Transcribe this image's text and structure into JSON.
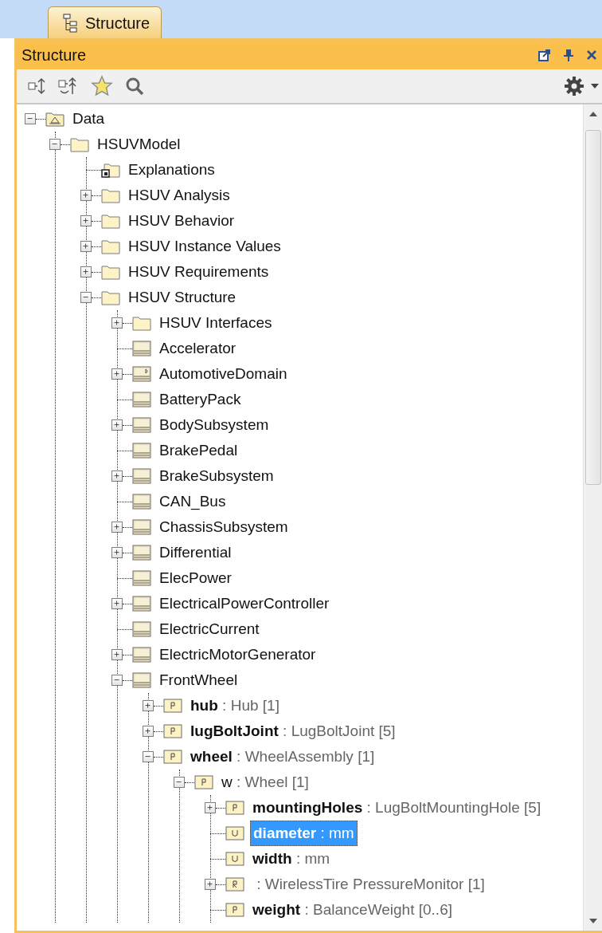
{
  "tab": {
    "label": "Structure",
    "selected": true
  },
  "panel": {
    "title": "Structure"
  },
  "tree": [
    {
      "label": "Data",
      "kind": "model",
      "expanded": true,
      "selected": false,
      "children": [
        {
          "label": "HSUVModel",
          "kind": "folder",
          "expanded": true,
          "selected": false,
          "children": [
            {
              "label": "Explanations",
              "kind": "diagram",
              "selected": false
            },
            {
              "label": "HSUV Analysis",
              "kind": "folder",
              "expanded": false,
              "selected": false
            },
            {
              "label": "HSUV Behavior",
              "kind": "folder",
              "expanded": false,
              "selected": false
            },
            {
              "label": "HSUV Instance Values",
              "kind": "folder",
              "expanded": false,
              "selected": false
            },
            {
              "label": "HSUV Requirements",
              "kind": "folder",
              "expanded": false,
              "selected": false
            },
            {
              "label": "HSUV Structure",
              "kind": "folder",
              "expanded": true,
              "selected": false,
              "children": [
                {
                  "label": "HSUV Interfaces",
                  "kind": "folder",
                  "expanded": false,
                  "selected": false
                },
                {
                  "label": "Accelerator",
                  "kind": "block",
                  "selected": false
                },
                {
                  "label": "AutomotiveDomain",
                  "kind": "domain-block",
                  "expanded": false,
                  "selected": false
                },
                {
                  "label": "BatteryPack",
                  "kind": "block",
                  "selected": false
                },
                {
                  "label": "BodySubsystem",
                  "kind": "block",
                  "expanded": false,
                  "selected": false
                },
                {
                  "label": "BrakePedal",
                  "kind": "block",
                  "selected": false
                },
                {
                  "label": "BrakeSubsystem",
                  "kind": "block",
                  "expanded": false,
                  "selected": false
                },
                {
                  "label": "CAN_Bus",
                  "kind": "block",
                  "selected": false
                },
                {
                  "label": "ChassisSubsystem",
                  "kind": "block",
                  "expanded": false,
                  "selected": false
                },
                {
                  "label": "Differential",
                  "kind": "block",
                  "expanded": false,
                  "selected": false
                },
                {
                  "label": "ElecPower",
                  "kind": "block",
                  "selected": false
                },
                {
                  "label": "ElectricalPowerController",
                  "kind": "block",
                  "expanded": false,
                  "selected": false
                },
                {
                  "label": "ElectricCurrent",
                  "kind": "block",
                  "selected": false
                },
                {
                  "label": "ElectricMotorGenerator",
                  "kind": "block",
                  "expanded": false,
                  "selected": false
                },
                {
                  "label": "FrontWheel",
                  "kind": "block",
                  "expanded": true,
                  "selected": false,
                  "children": [
                    {
                      "label": "hub",
                      "type": ": Hub [1]",
                      "bold": true,
                      "kind": "part",
                      "expanded": false,
                      "selected": false
                    },
                    {
                      "label": "lugBoltJoint",
                      "type": ": LugBoltJoint [5]",
                      "bold": true,
                      "kind": "part",
                      "expanded": false,
                      "selected": false
                    },
                    {
                      "label": "wheel",
                      "type": ": WheelAssembly [1]",
                      "bold": true,
                      "kind": "part",
                      "expanded": true,
                      "selected": false,
                      "children": [
                        {
                          "label": "w",
                          "type": ": Wheel [1]",
                          "bold": false,
                          "kind": "part",
                          "expanded": true,
                          "selected": false,
                          "children": [
                            {
                              "label": "mountingHoles",
                              "type": ": LugBoltMountingHole [5]",
                              "bold": true,
                              "kind": "part",
                              "expanded": false,
                              "selected": false
                            },
                            {
                              "label": "diameter",
                              "type": ": mm",
                              "bold": true,
                              "kind": "value",
                              "selected": true
                            },
                            {
                              "label": "width",
                              "type": ": mm",
                              "bold": true,
                              "kind": "value",
                              "selected": false
                            },
                            {
                              "type": ": WirelessTire PressureMonitor [1]",
                              "bold": true,
                              "kind": "reference",
                              "expanded": false,
                              "selected": false
                            },
                            {
                              "label": "weight",
                              "type": ": BalanceWeight [0..6]",
                              "bold": true,
                              "kind": "part",
                              "selected": false
                            }
                          ]
                        }
                      ]
                    }
                  ]
                }
              ]
            }
          ]
        }
      ]
    }
  ]
}
